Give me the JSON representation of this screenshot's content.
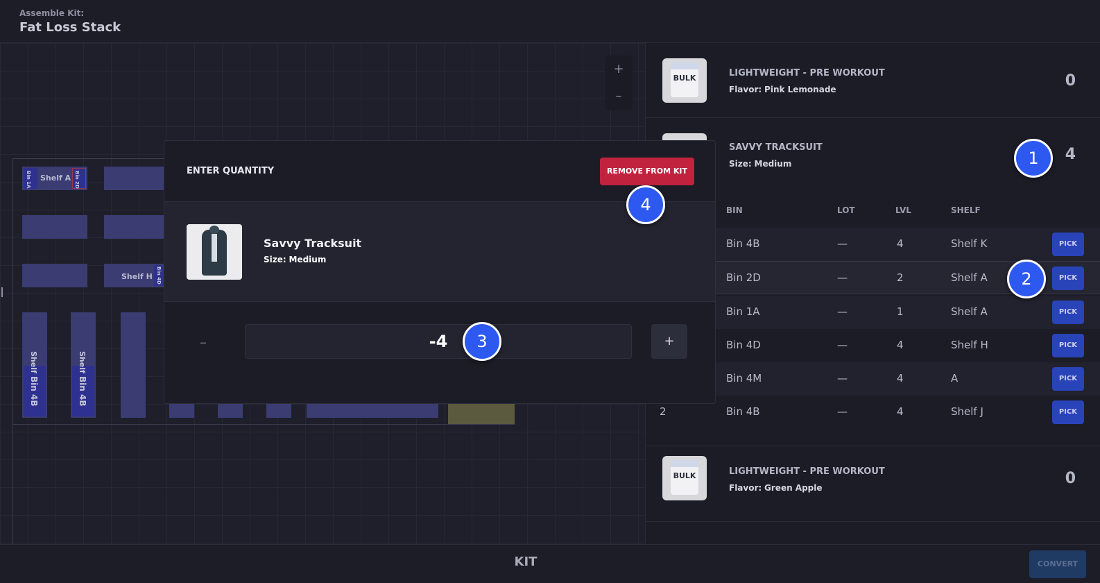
{
  "header": {
    "label": "Assemble Kit:",
    "title": "Fat Loss Stack"
  },
  "map": {
    "zoom_in": "+",
    "zoom_out": "–",
    "shelf_a_label": "Shelf A",
    "shelf_a_bin1": "Bin 1A",
    "shelf_a_bin2": "Bin 2D",
    "shelf_h_label": "Shelf H",
    "shelf_h_bin": "Bin 4D",
    "col1_shelf": "Shelf",
    "col1_bin": "Bin 4B",
    "col2_shelf": "Shelf",
    "col2_bin": "Bin 4B"
  },
  "products": [
    {
      "name": "LIGHTWEIGHT - PRE WORKOUT",
      "attr_label": "Flavor:",
      "attr_value": "Pink Lemonade",
      "qty": "0",
      "thumb_text": "BULK"
    },
    {
      "name": "SAVVY TRACKSUIT",
      "attr_label": "Size:",
      "attr_value": "Medium",
      "qty": "4"
    },
    {
      "name": "LIGHTWEIGHT - PRE WORKOUT",
      "attr_label": "Flavor:",
      "attr_value": "Green Apple",
      "qty": "0",
      "thumb_text": "BULK"
    }
  ],
  "bin_table": {
    "headers": {
      "bin": "BIN",
      "lot": "LOT",
      "lvl": "LVL",
      "shelf": "SHELF"
    },
    "pick_label": "PICK",
    "rows": [
      {
        "qty": "",
        "bin": "Bin 4B",
        "lot": "—",
        "lvl": "4",
        "shelf": "Shelf K"
      },
      {
        "qty": "",
        "bin": "Bin 2D",
        "lot": "—",
        "lvl": "2",
        "shelf": "Shelf A"
      },
      {
        "qty": "",
        "bin": "Bin 1A",
        "lot": "—",
        "lvl": "1",
        "shelf": "Shelf A"
      },
      {
        "qty": "",
        "bin": "Bin 4D",
        "lot": "—",
        "lvl": "4",
        "shelf": "Shelf H"
      },
      {
        "qty": "",
        "bin": "Bin 4M",
        "lot": "—",
        "lvl": "4",
        "shelf": "A"
      },
      {
        "qty": "2",
        "bin": "Bin 4B",
        "lot": "—",
        "lvl": "4",
        "shelf": "Shelf J"
      }
    ]
  },
  "modal": {
    "title": "ENTER QUANTITY",
    "remove_label": "REMOVE FROM KIT",
    "item_name": "Savvy Tracksuit",
    "item_attr_label": "Size:",
    "item_attr_value": "Medium",
    "minus": "–",
    "plus": "+",
    "quantity_value": "-4"
  },
  "footer": {
    "title": "KIT",
    "convert_label": "CONVERT"
  },
  "markers": [
    "1",
    "2",
    "3",
    "4"
  ],
  "colors": {
    "accent": "#2d59f0",
    "danger": "#c1233f",
    "pick": "#2943b8"
  }
}
